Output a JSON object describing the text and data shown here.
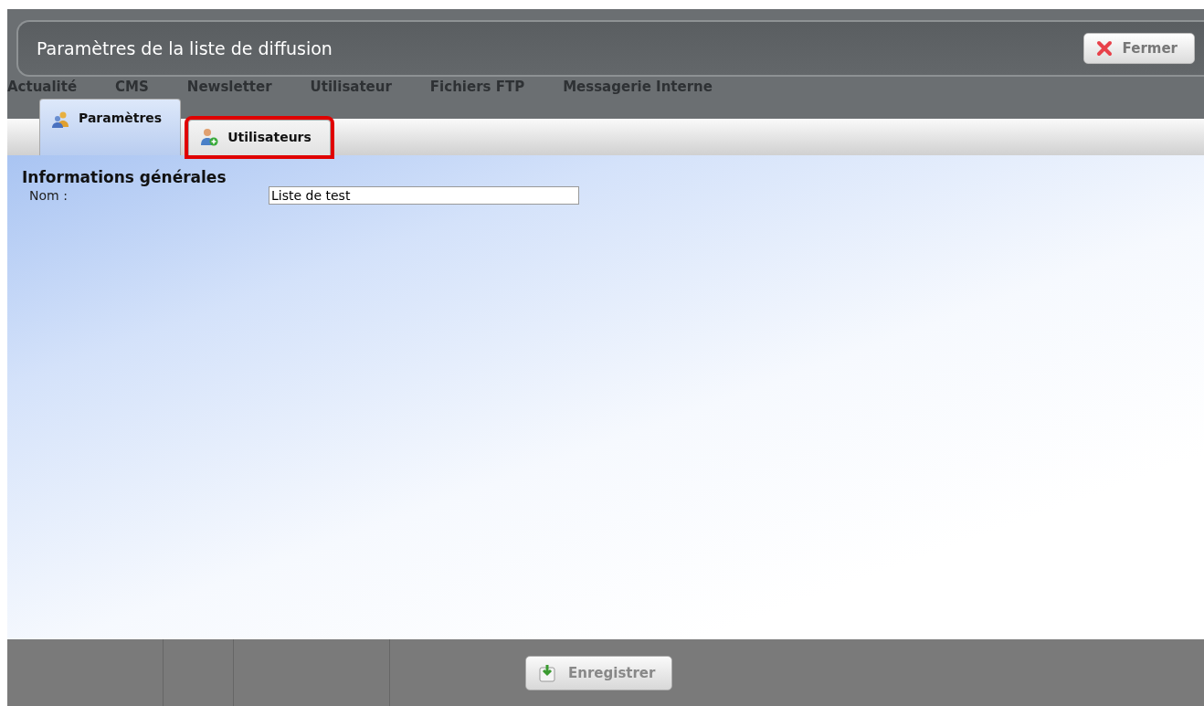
{
  "window": {
    "title": "Paramètres de la liste de diffusion",
    "close_button": "Fermer"
  },
  "background_nav": [
    {
      "label": "Actualité"
    },
    {
      "label": "CMS"
    },
    {
      "label": "Newsletter"
    },
    {
      "label": "Utilisateur"
    },
    {
      "label": "Fichiers FTP"
    },
    {
      "label": "Messagerie Interne"
    }
  ],
  "tabs": [
    {
      "label": "Paramètres",
      "selected": true,
      "highlighted": false
    },
    {
      "label": "Utilisateurs",
      "selected": false,
      "highlighted": true
    }
  ],
  "section": {
    "title": "Informations générales",
    "fields": [
      {
        "label": "Nom :",
        "value": "Liste de test"
      }
    ]
  },
  "footer": {
    "save_button": "Enregistrer"
  }
}
